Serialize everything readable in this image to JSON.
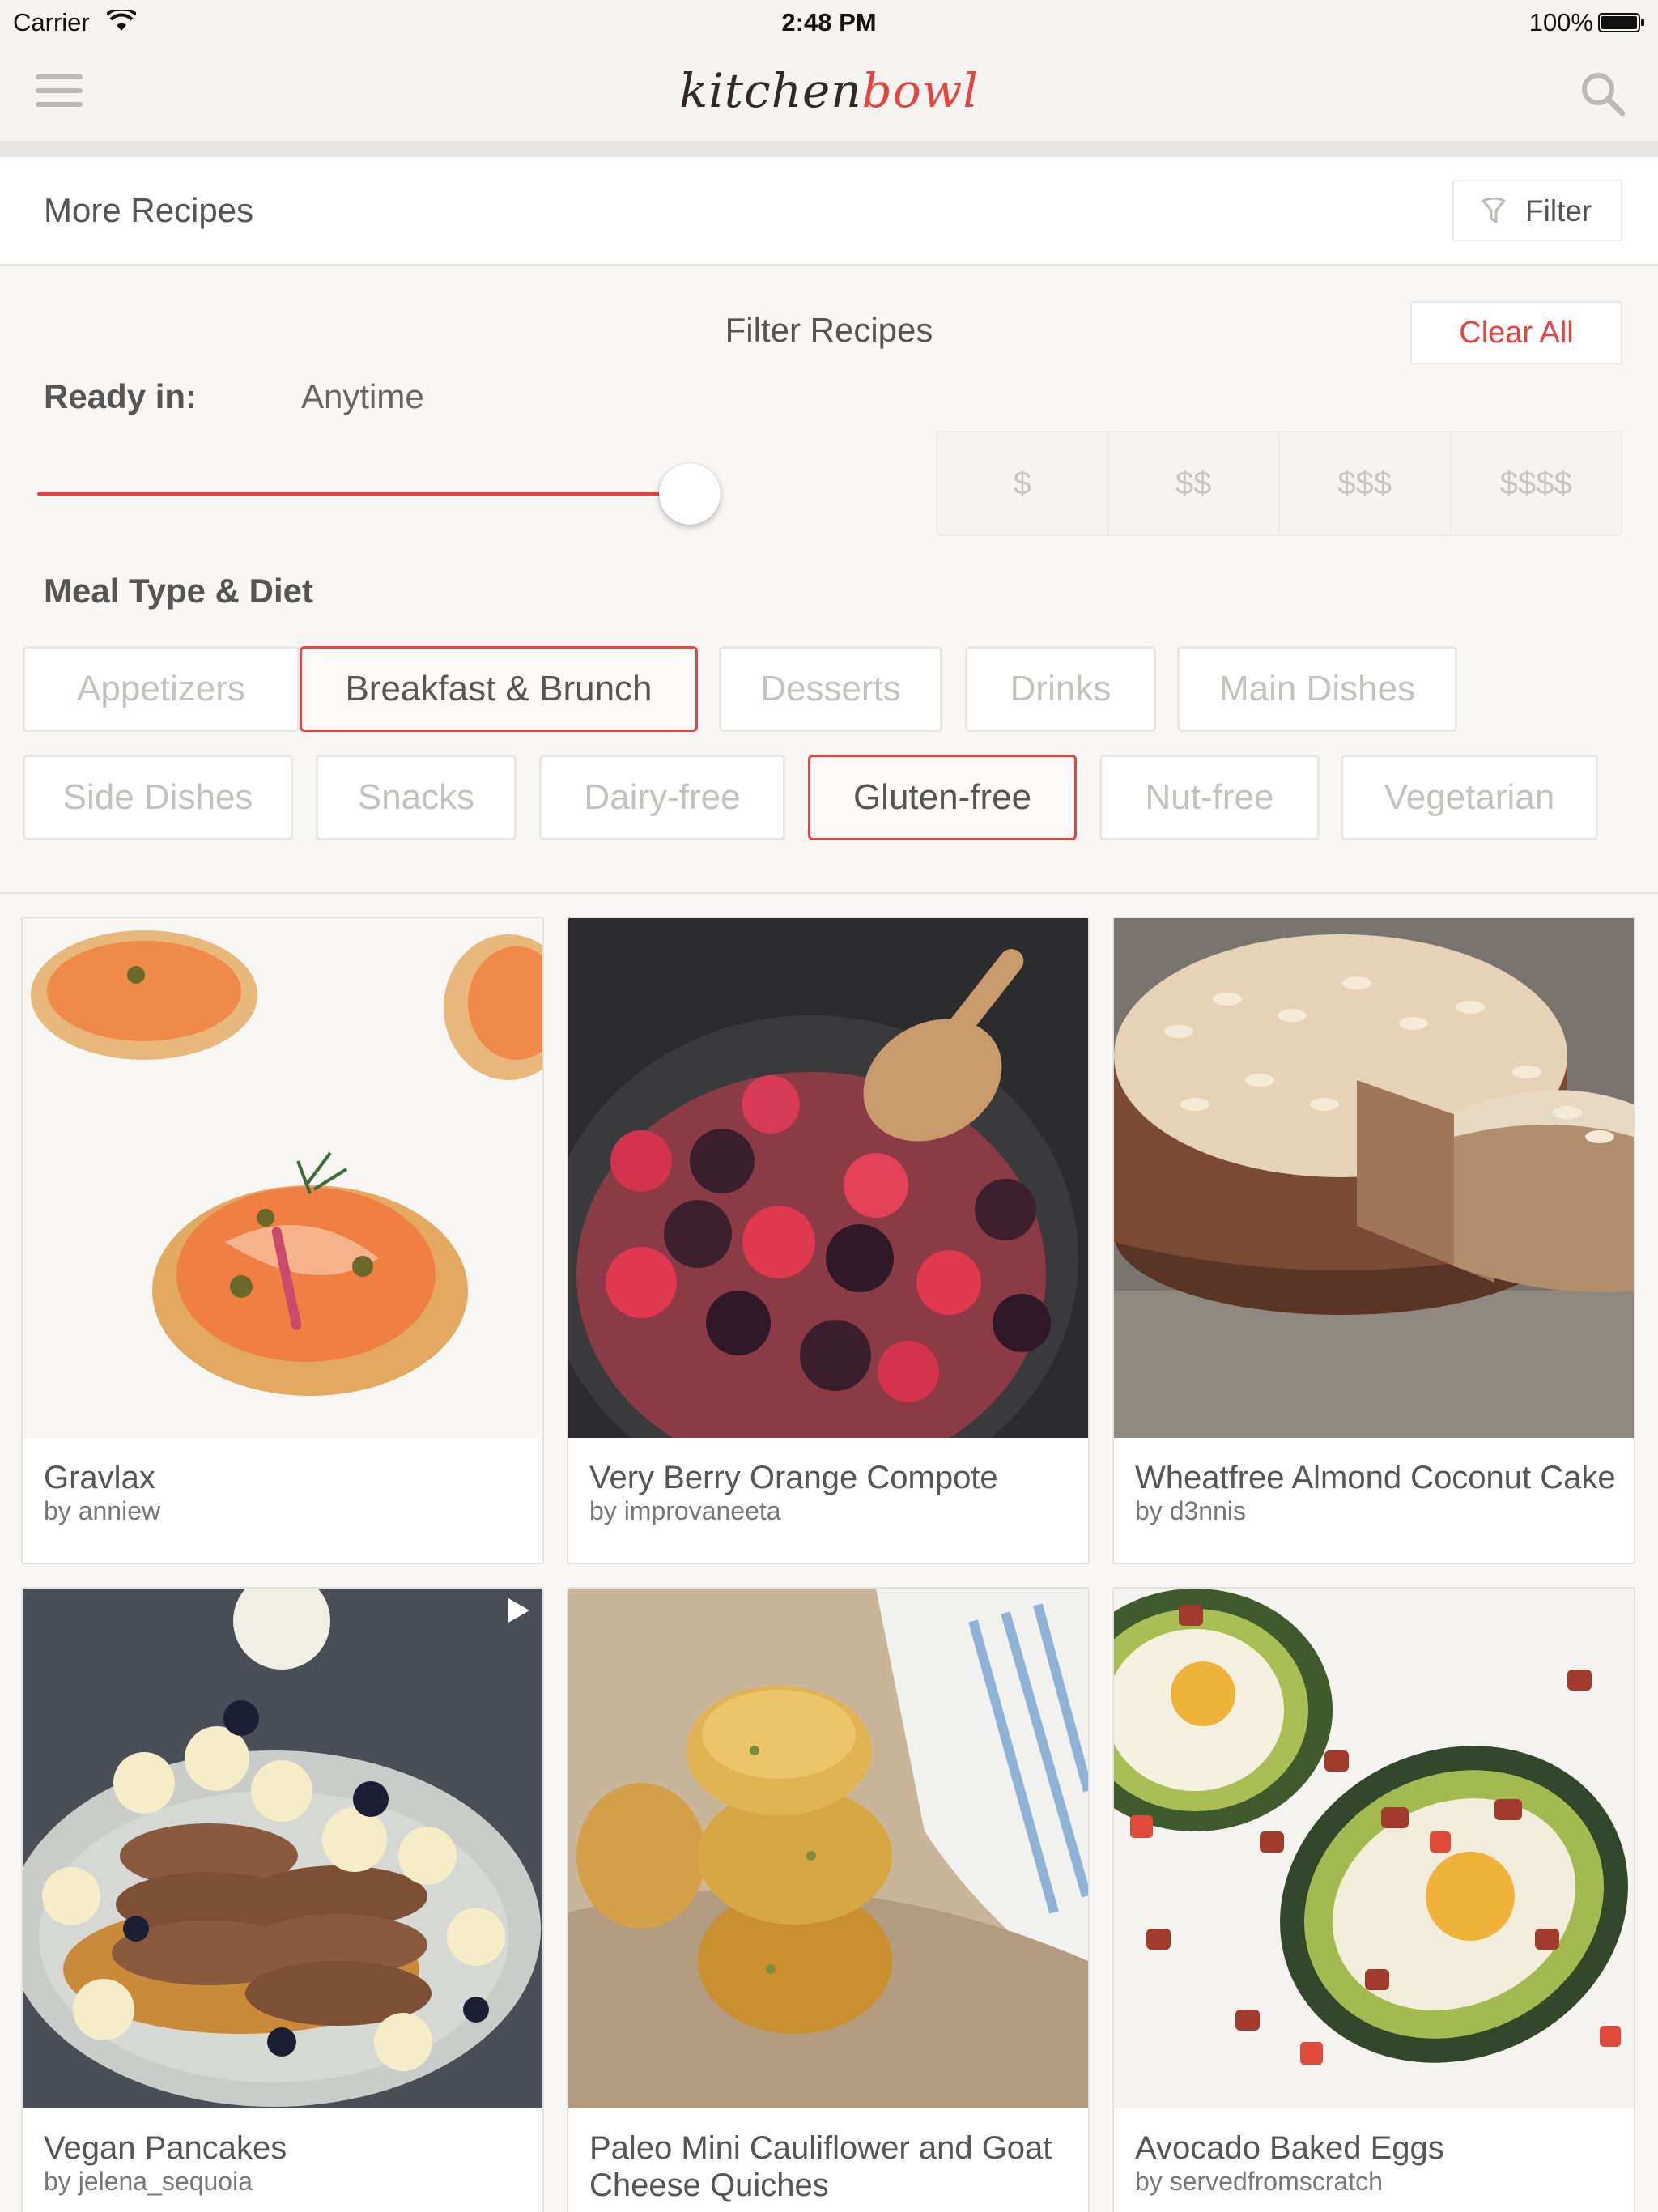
{
  "status_bar": {
    "carrier": "Carrier",
    "time": "2:48 PM",
    "battery": "100%"
  },
  "nav": {
    "logo_part1": "kitchen",
    "logo_part2": "bowl"
  },
  "header": {
    "title": "More Recipes",
    "filter_label": "Filter"
  },
  "filter_panel": {
    "title": "Filter Recipes",
    "clear_all": "Clear All",
    "ready_label": "Ready in:",
    "ready_value": "Anytime",
    "ready_slider_fraction": 1.0,
    "price_options": [
      "$",
      "$$",
      "$$$",
      "$$$$"
    ],
    "meal_label": "Meal Type & Diet",
    "chips": [
      {
        "label": "Appetizers",
        "active": false
      },
      {
        "label": "Breakfast & Brunch",
        "active": true
      },
      {
        "label": "Desserts",
        "active": false
      },
      {
        "label": "Drinks",
        "active": false
      },
      {
        "label": "Main Dishes",
        "active": false
      },
      {
        "label": "Side Dishes",
        "active": false
      },
      {
        "label": "Snacks",
        "active": false
      },
      {
        "label": "Dairy-free",
        "active": false
      },
      {
        "label": "Gluten-free",
        "active": true
      },
      {
        "label": "Nut-free",
        "active": false
      },
      {
        "label": "Vegetarian",
        "active": false
      }
    ]
  },
  "recipes": [
    {
      "title": "Gravlax",
      "author": "by anniew"
    },
    {
      "title": "Very Berry Orange Compote",
      "author": "by improvaneeta"
    },
    {
      "title": "Wheatfree Almond Coconut Cake",
      "author": "by d3nnis"
    },
    {
      "title": "Vegan Pancakes",
      "author": "by jelena_sequoia",
      "video": true
    },
    {
      "title": "Paleo Mini Cauliflower and Goat Cheese Quiches",
      "author": ""
    },
    {
      "title": "Avocado Baked Eggs",
      "author": "by servedfromscratch"
    }
  ],
  "colors": {
    "accent": "#e8433f",
    "logo_dark": "#2f2a28",
    "background": "#f8f7f5"
  }
}
